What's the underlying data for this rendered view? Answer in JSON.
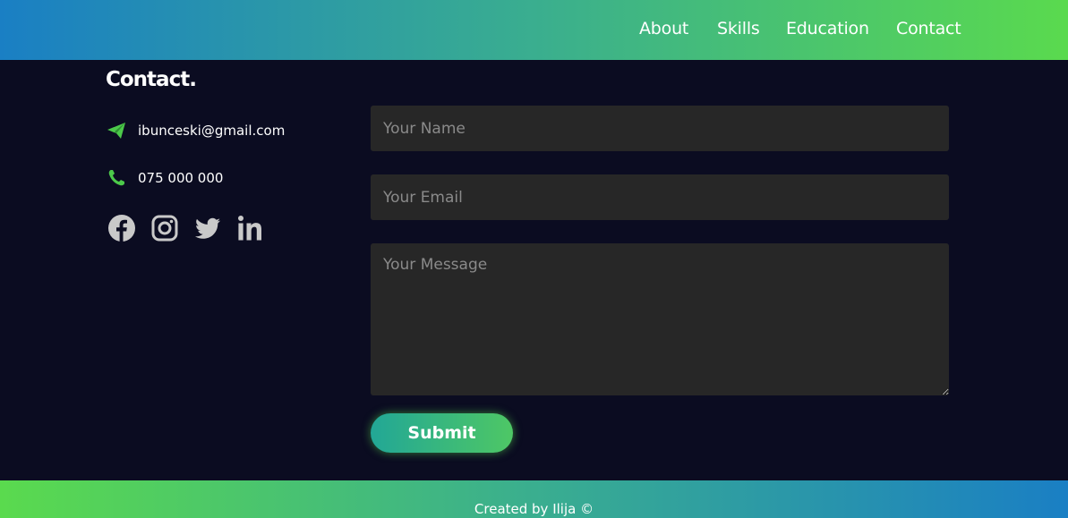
{
  "nav": {
    "items": [
      {
        "label": "About"
      },
      {
        "label": "Skills"
      },
      {
        "label": "Education"
      },
      {
        "label": "Contact"
      }
    ]
  },
  "contact": {
    "title": "Contact.",
    "email": "ibunceski@gmail.com",
    "phone": "075 000 000",
    "email_icon": "paper-plane-icon",
    "phone_icon": "phone-icon",
    "socials": [
      "facebook-icon",
      "instagram-icon",
      "twitter-icon",
      "linkedin-icon"
    ]
  },
  "form": {
    "name_placeholder": "Your Name",
    "email_placeholder": "Your Email",
    "message_placeholder": "Your Message",
    "submit_label": "Submit"
  },
  "footer": {
    "credit": "Created by Ilija ©"
  },
  "colors": {
    "background": "#0b0c21",
    "accent_green": "#5ada4e",
    "accent_blue": "#1a7fc4",
    "field_bg": "#272727",
    "icon_gray": "#c9c9c9"
  }
}
